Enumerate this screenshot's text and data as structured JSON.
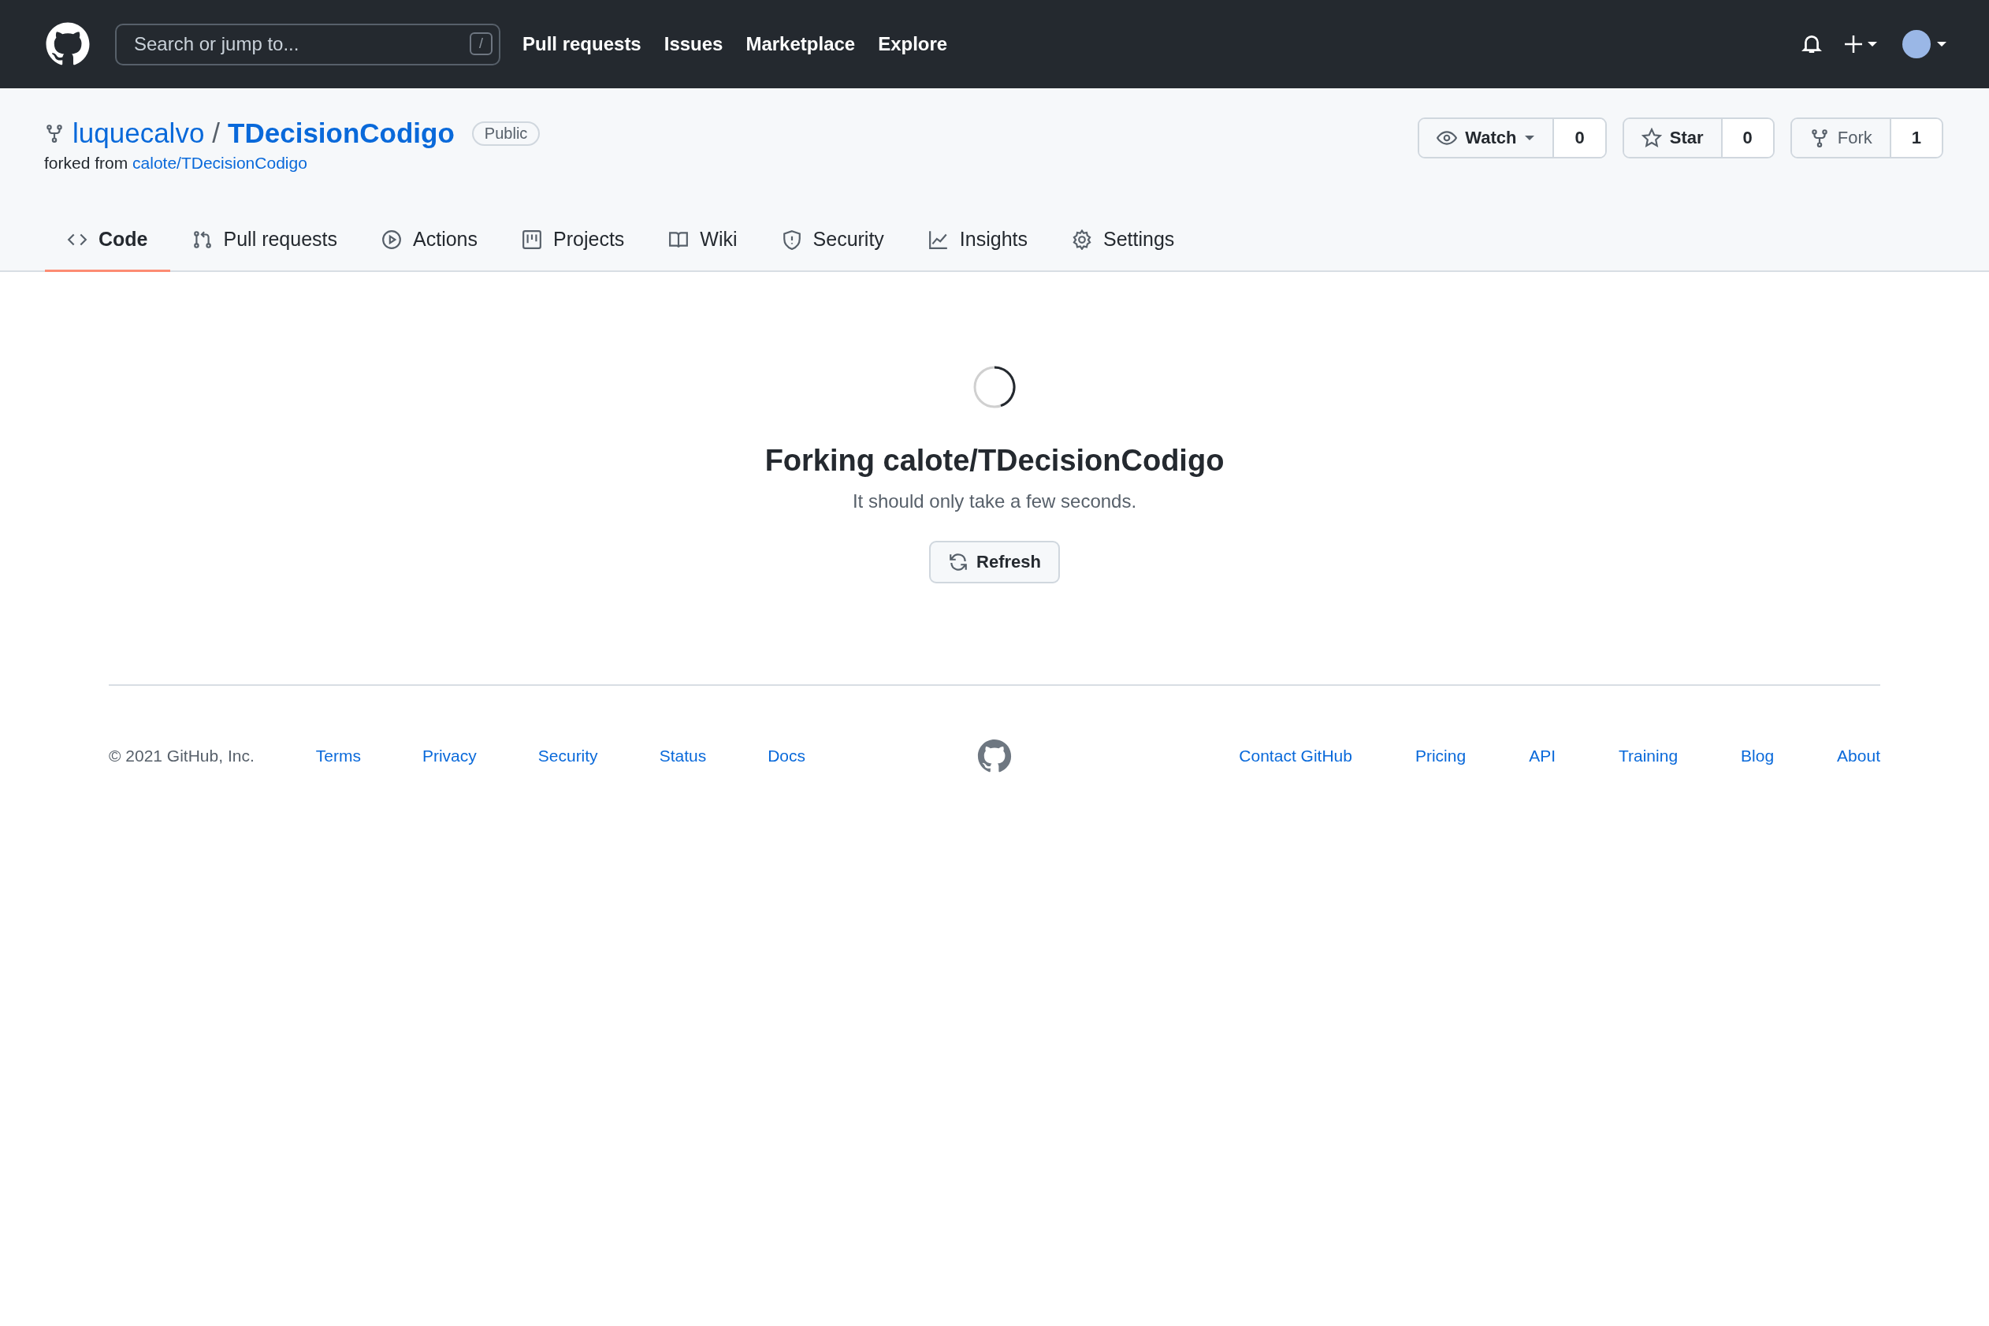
{
  "header": {
    "search": {
      "placeholder": "Search or jump to...",
      "shortcut": "/"
    },
    "nav": [
      "Pull requests",
      "Issues",
      "Marketplace",
      "Explore"
    ]
  },
  "repo": {
    "owner": "luquecalvo",
    "separator": "/",
    "name": "TDecisionCodigo",
    "visibility": "Public",
    "forked_label": "forked from",
    "forked_from": "calote/TDecisionCodigo"
  },
  "actions": [
    {
      "kind": "watch",
      "label": "Watch",
      "count": "0"
    },
    {
      "kind": "star",
      "label": "Star",
      "count": "0"
    },
    {
      "kind": "fork",
      "label": "Fork",
      "count": "1"
    }
  ],
  "tabs": [
    {
      "label": "Code",
      "selected": true
    },
    {
      "label": "Pull requests",
      "selected": false
    },
    {
      "label": "Actions",
      "selected": false
    },
    {
      "label": "Projects",
      "selected": false
    },
    {
      "label": "Wiki",
      "selected": false
    },
    {
      "label": "Security",
      "selected": false
    },
    {
      "label": "Insights",
      "selected": false
    },
    {
      "label": "Settings",
      "selected": false
    }
  ],
  "fork_status": {
    "heading": "Forking calote/TDecisionCodigo",
    "message": "It should only take a few seconds.",
    "button": "Refresh"
  },
  "footer": {
    "copyright": "© 2021 GitHub, Inc.",
    "left_links": [
      "Terms",
      "Privacy",
      "Security",
      "Status",
      "Docs"
    ],
    "right_links": [
      "Contact GitHub",
      "Pricing",
      "API",
      "Training",
      "Blog",
      "About"
    ]
  }
}
